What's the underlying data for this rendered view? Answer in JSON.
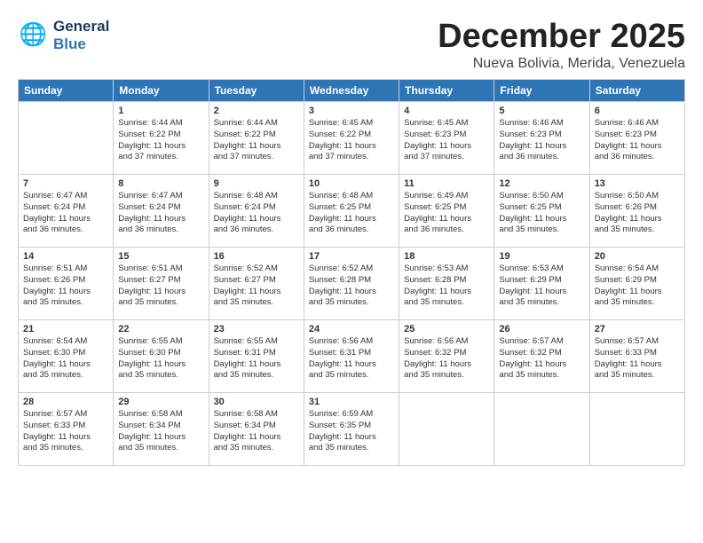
{
  "header": {
    "logo_general": "General",
    "logo_blue": "Blue",
    "month": "December 2025",
    "location": "Nueva Bolivia, Merida, Venezuela"
  },
  "days": [
    "Sunday",
    "Monday",
    "Tuesday",
    "Wednesday",
    "Thursday",
    "Friday",
    "Saturday"
  ],
  "weeks": [
    [
      {
        "day": "",
        "info": ""
      },
      {
        "day": "1",
        "info": "Sunrise: 6:44 AM\nSunset: 6:22 PM\nDaylight: 11 hours\nand 37 minutes."
      },
      {
        "day": "2",
        "info": "Sunrise: 6:44 AM\nSunset: 6:22 PM\nDaylight: 11 hours\nand 37 minutes."
      },
      {
        "day": "3",
        "info": "Sunrise: 6:45 AM\nSunset: 6:22 PM\nDaylight: 11 hours\nand 37 minutes."
      },
      {
        "day": "4",
        "info": "Sunrise: 6:45 AM\nSunset: 6:23 PM\nDaylight: 11 hours\nand 37 minutes."
      },
      {
        "day": "5",
        "info": "Sunrise: 6:46 AM\nSunset: 6:23 PM\nDaylight: 11 hours\nand 36 minutes."
      },
      {
        "day": "6",
        "info": "Sunrise: 6:46 AM\nSunset: 6:23 PM\nDaylight: 11 hours\nand 36 minutes."
      }
    ],
    [
      {
        "day": "7",
        "info": "Sunrise: 6:47 AM\nSunset: 6:24 PM\nDaylight: 11 hours\nand 36 minutes."
      },
      {
        "day": "8",
        "info": "Sunrise: 6:47 AM\nSunset: 6:24 PM\nDaylight: 11 hours\nand 36 minutes."
      },
      {
        "day": "9",
        "info": "Sunrise: 6:48 AM\nSunset: 6:24 PM\nDaylight: 11 hours\nand 36 minutes."
      },
      {
        "day": "10",
        "info": "Sunrise: 6:48 AM\nSunset: 6:25 PM\nDaylight: 11 hours\nand 36 minutes."
      },
      {
        "day": "11",
        "info": "Sunrise: 6:49 AM\nSunset: 6:25 PM\nDaylight: 11 hours\nand 36 minutes."
      },
      {
        "day": "12",
        "info": "Sunrise: 6:50 AM\nSunset: 6:25 PM\nDaylight: 11 hours\nand 35 minutes."
      },
      {
        "day": "13",
        "info": "Sunrise: 6:50 AM\nSunset: 6:26 PM\nDaylight: 11 hours\nand 35 minutes."
      }
    ],
    [
      {
        "day": "14",
        "info": "Sunrise: 6:51 AM\nSunset: 6:26 PM\nDaylight: 11 hours\nand 35 minutes."
      },
      {
        "day": "15",
        "info": "Sunrise: 6:51 AM\nSunset: 6:27 PM\nDaylight: 11 hours\nand 35 minutes."
      },
      {
        "day": "16",
        "info": "Sunrise: 6:52 AM\nSunset: 6:27 PM\nDaylight: 11 hours\nand 35 minutes."
      },
      {
        "day": "17",
        "info": "Sunrise: 6:52 AM\nSunset: 6:28 PM\nDaylight: 11 hours\nand 35 minutes."
      },
      {
        "day": "18",
        "info": "Sunrise: 6:53 AM\nSunset: 6:28 PM\nDaylight: 11 hours\nand 35 minutes."
      },
      {
        "day": "19",
        "info": "Sunrise: 6:53 AM\nSunset: 6:29 PM\nDaylight: 11 hours\nand 35 minutes."
      },
      {
        "day": "20",
        "info": "Sunrise: 6:54 AM\nSunset: 6:29 PM\nDaylight: 11 hours\nand 35 minutes."
      }
    ],
    [
      {
        "day": "21",
        "info": "Sunrise: 6:54 AM\nSunset: 6:30 PM\nDaylight: 11 hours\nand 35 minutes."
      },
      {
        "day": "22",
        "info": "Sunrise: 6:55 AM\nSunset: 6:30 PM\nDaylight: 11 hours\nand 35 minutes."
      },
      {
        "day": "23",
        "info": "Sunrise: 6:55 AM\nSunset: 6:31 PM\nDaylight: 11 hours\nand 35 minutes."
      },
      {
        "day": "24",
        "info": "Sunrise: 6:56 AM\nSunset: 6:31 PM\nDaylight: 11 hours\nand 35 minutes."
      },
      {
        "day": "25",
        "info": "Sunrise: 6:56 AM\nSunset: 6:32 PM\nDaylight: 11 hours\nand 35 minutes."
      },
      {
        "day": "26",
        "info": "Sunrise: 6:57 AM\nSunset: 6:32 PM\nDaylight: 11 hours\nand 35 minutes."
      },
      {
        "day": "27",
        "info": "Sunrise: 6:57 AM\nSunset: 6:33 PM\nDaylight: 11 hours\nand 35 minutes."
      }
    ],
    [
      {
        "day": "28",
        "info": "Sunrise: 6:57 AM\nSunset: 6:33 PM\nDaylight: 11 hours\nand 35 minutes."
      },
      {
        "day": "29",
        "info": "Sunrise: 6:58 AM\nSunset: 6:34 PM\nDaylight: 11 hours\nand 35 minutes."
      },
      {
        "day": "30",
        "info": "Sunrise: 6:58 AM\nSunset: 6:34 PM\nDaylight: 11 hours\nand 35 minutes."
      },
      {
        "day": "31",
        "info": "Sunrise: 6:59 AM\nSunset: 6:35 PM\nDaylight: 11 hours\nand 35 minutes."
      },
      {
        "day": "",
        "info": ""
      },
      {
        "day": "",
        "info": ""
      },
      {
        "day": "",
        "info": ""
      }
    ]
  ]
}
